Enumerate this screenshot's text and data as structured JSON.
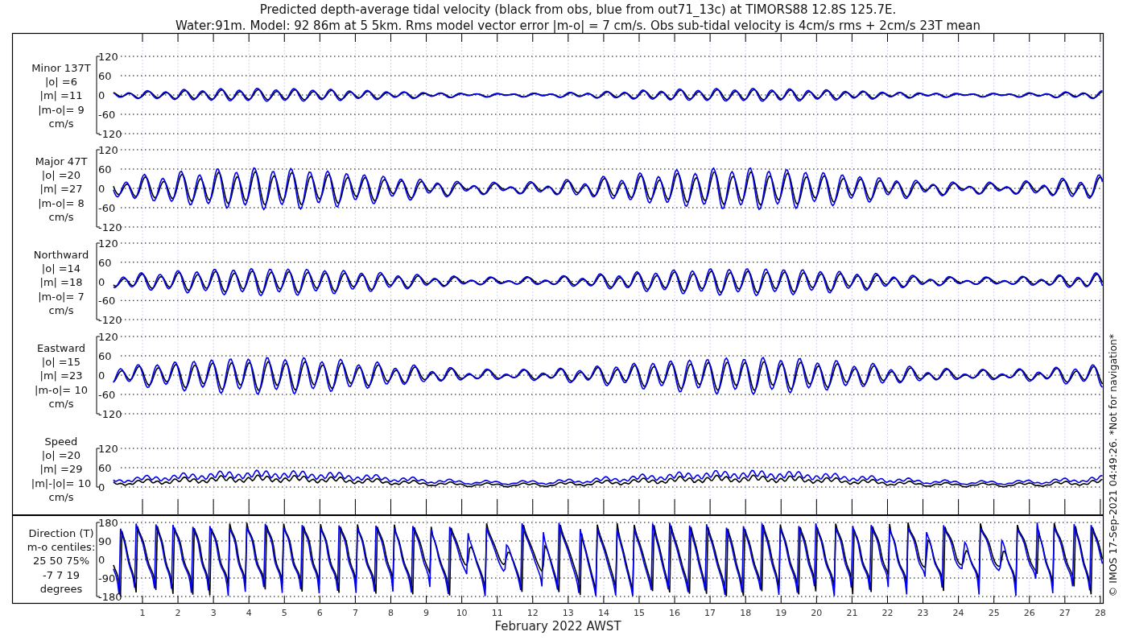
{
  "title_lines": [
    "Predicted depth-average tidal velocity (black from obs, blue from out71_13c) at TIMORS88 12.8S 125.7E.",
    "Water:91m. Model: 92 86m at 5 5km. Rms model vector error |m-o| = 7 cm/s. Obs sub-tidal velocity is 4cm/s rms + 2cm/s 23T mean"
  ],
  "panels": [
    {
      "kind": "velocity",
      "label_lines": [
        "Minor 137T",
        "|o| =6",
        "|m| =11",
        "|m-o|= 9",
        "cm/s"
      ],
      "yticks": [
        "120",
        "60",
        "0",
        "-60",
        "-120"
      ]
    },
    {
      "kind": "velocity",
      "label_lines": [
        "Major 47T",
        "|o| =20",
        "|m| =27",
        "|m-o|= 8",
        "cm/s"
      ],
      "yticks": [
        "120",
        "60",
        "0",
        "-60",
        "-120"
      ]
    },
    {
      "kind": "velocity",
      "label_lines": [
        "Northward",
        "|o| =14",
        "|m| =18",
        "|m-o|= 7",
        "cm/s"
      ],
      "yticks": [
        "120",
        "60",
        "0",
        "-60",
        "-120"
      ]
    },
    {
      "kind": "velocity",
      "label_lines": [
        "Eastward",
        "|o| =15",
        "|m| =23",
        "|m-o|= 10",
        "cm/s"
      ],
      "yticks": [
        "120",
        "60",
        "0",
        "-60",
        "-120"
      ]
    },
    {
      "kind": "speed",
      "label_lines": [
        "Speed",
        "|o| =20",
        "|m| =29",
        "|m|-|o|= 10",
        "cm/s"
      ],
      "yticks": [
        "120",
        "60",
        "0"
      ]
    },
    {
      "kind": "direction",
      "label_lines": [
        "Direction (T)",
        "m-o centiles:",
        "25  50  75%",
        "-7   7  19",
        "degrees"
      ],
      "yticks": [
        "180",
        "90",
        "0",
        "-90",
        "-180"
      ]
    }
  ],
  "days": [
    "1",
    "2",
    "3",
    "4",
    "5",
    "6",
    "7",
    "8",
    "9",
    "10",
    "11",
    "12",
    "13",
    "14",
    "15",
    "16",
    "17",
    "18",
    "19",
    "20",
    "21",
    "22",
    "23",
    "24",
    "25",
    "26",
    "27",
    "28"
  ],
  "xlabel": "February 2022 AWST",
  "credit": "© IMOS 17-Sep-2021 04:49:26. *Not for navigation*"
}
